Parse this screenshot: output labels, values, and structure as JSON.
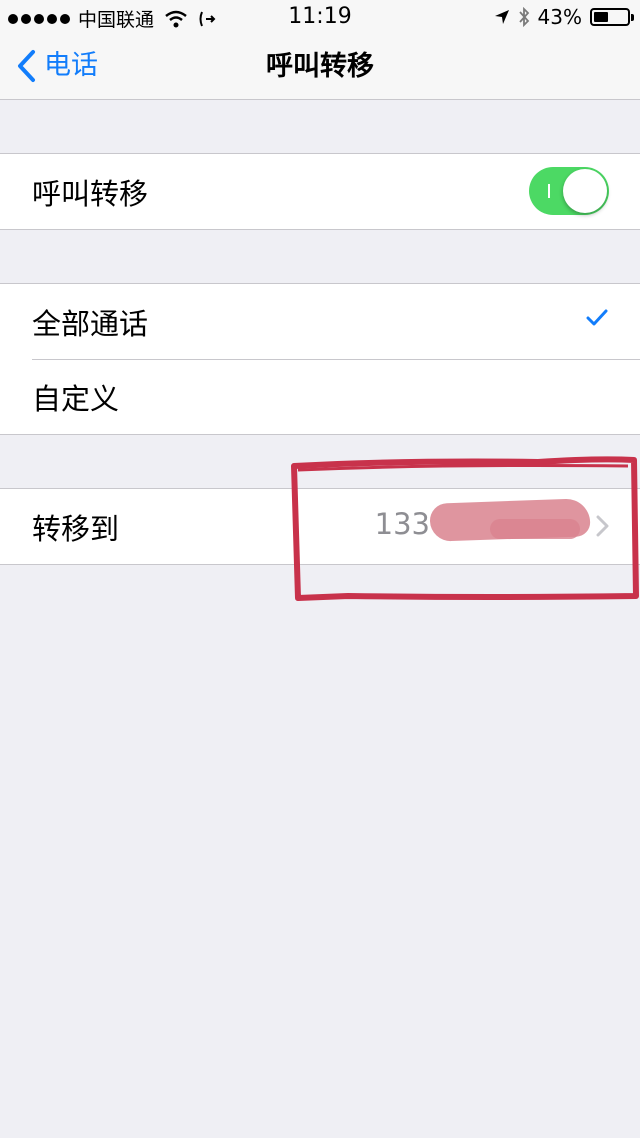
{
  "status_bar": {
    "carrier": "中国联通",
    "time": "11:19",
    "battery": "43%",
    "battery_level": 0.43
  },
  "nav": {
    "back_label": "电话",
    "title": "呼叫转移"
  },
  "call_forwarding": {
    "label": "呼叫转移",
    "enabled": true
  },
  "options": [
    {
      "label": "全部通话",
      "selected": true
    },
    {
      "label": "自定义",
      "selected": false
    }
  ],
  "forward_to": {
    "label": "转移到",
    "value": "133"
  },
  "colors": {
    "accent": "#127dfb",
    "toggle_on": "#4cd964",
    "annotation": "#c8324b",
    "background": "#efeff4"
  }
}
